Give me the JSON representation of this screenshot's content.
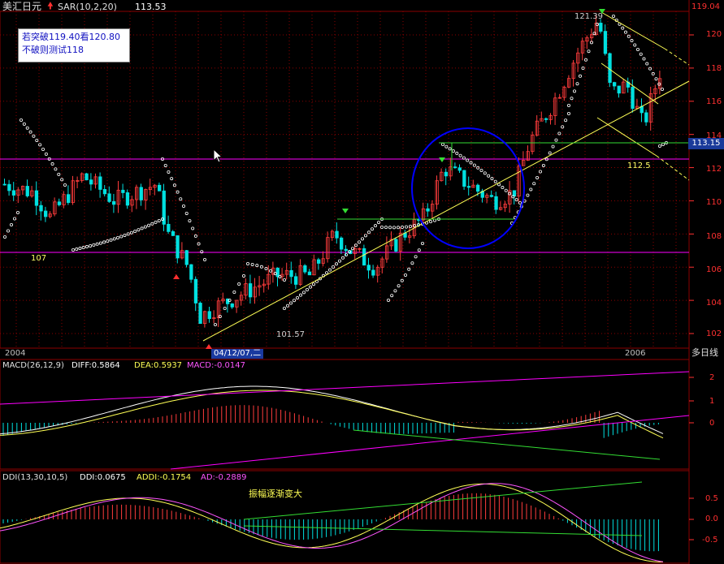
{
  "header": {
    "title": "美汇日元",
    "indicator_label": "SAR(10,2,20)",
    "indicator_value": "113.53"
  },
  "note": {
    "line1": "若突破119.40看120.80",
    "line2": "不破则测试118"
  },
  "price_axis": {
    "ticks": [
      "120",
      "118",
      "116",
      "114",
      "112",
      "110",
      "108",
      "106",
      "104",
      "102"
    ],
    "top_value": "119.04",
    "current_value": "113.15"
  },
  "annotations": {
    "high": "121.39",
    "low": "101.57",
    "support": "112.5",
    "level_107": "107"
  },
  "time_axis": {
    "start": "2004",
    "cursor_date": "04/12/07,二",
    "year_2006": "2006",
    "period": "多日线"
  },
  "macd": {
    "label": "MACD(26,12,9)",
    "diff": "DIFF:0.5864",
    "dea": "DEA:0.5937",
    "macd": "MACD:-0.0147",
    "ticks": [
      "2",
      "1",
      "0"
    ]
  },
  "ddi": {
    "label": "DDI(13,30,10,5)",
    "ddi": "DDI:0.0675",
    "addi": "ADDI:-0.1754",
    "ad": "AD:-0.2889",
    "comment": "振幅逐渐变大",
    "ticks": [
      "0.5",
      "0.0",
      "-0.5"
    ]
  },
  "colors": {
    "up_candle": "#ff3c3c",
    "down_candle": "#00e0e0",
    "grid": "#8b0000",
    "magenta_line": "#ff00ff",
    "trend_yellow": "#ffff55",
    "sar_dots": "#ffffff",
    "circle": "#0000ff",
    "green_line": "#33dd33",
    "badge_bg": "#1a3a9a"
  }
}
